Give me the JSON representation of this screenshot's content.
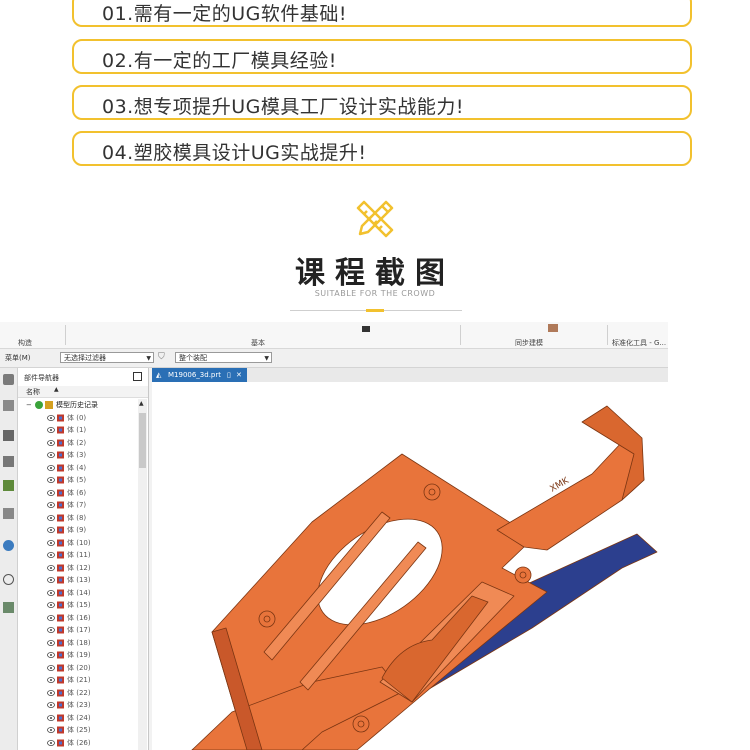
{
  "requirements": [
    "01.需有一定的UG软件基础!",
    "02.有一定的工厂模具经验!",
    "03.想专项提升UG模具工厂设计实战能力!",
    "04.塑胶模具设计UG实战提升!"
  ],
  "section": {
    "icon": "pencil-ruler-icon",
    "title": "课程截图",
    "subtitle": "SUITABLE FOR THE CROWD"
  },
  "colors": {
    "accent": "#f2c12e",
    "part": "#e8743b",
    "tab": "#2a6fb5"
  },
  "ug": {
    "ribbon_groups": [
      "构造",
      "基本",
      "同步建模",
      "标准化工具 - G..."
    ],
    "menu_label": "菜单(M)",
    "filter_select": "无选择过滤器",
    "assembly_select": "整个装配",
    "navigator_title": "部件导航器",
    "column_name": "名称",
    "tree_root": "模型历史记录",
    "bodies": [
      "体 (0)",
      "体 (1)",
      "体 (2)",
      "体 (3)",
      "体 (4)",
      "体 (5)",
      "体 (6)",
      "体 (7)",
      "体 (8)",
      "体 (9)",
      "体 (10)",
      "体 (11)",
      "体 (12)",
      "体 (13)",
      "体 (14)",
      "体 (15)",
      "体 (16)",
      "体 (17)",
      "体 (18)",
      "体 (19)",
      "体 (20)",
      "体 (21)",
      "体 (22)",
      "体 (23)",
      "体 (24)",
      "体 (25)",
      "体 (26)"
    ],
    "file_tab": "M19006_3d.prt",
    "engraving": "XMK"
  }
}
